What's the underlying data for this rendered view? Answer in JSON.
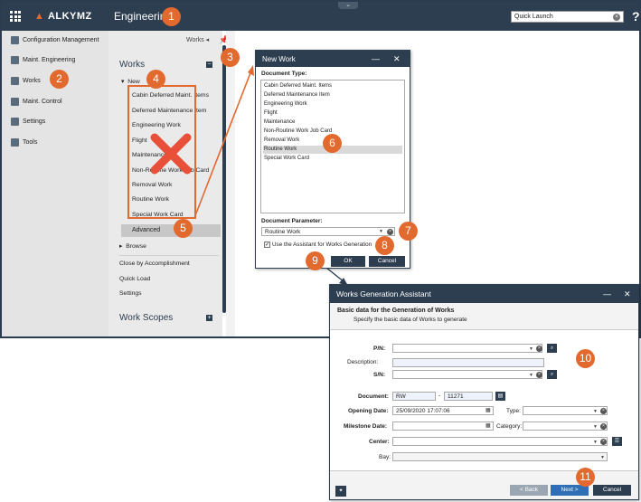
{
  "app": {
    "brand": "ALKYMZ",
    "title": "Engineering",
    "quick_launch_placeholder": "Quick Launch",
    "help": "?"
  },
  "nav": {
    "items": [
      {
        "label": "Configuration Management",
        "icon": "config-icon"
      },
      {
        "label": "Maint. Engineering",
        "icon": "maint-engineering-icon"
      },
      {
        "label": "Works",
        "icon": "works-icon"
      },
      {
        "label": "Maint. Control",
        "icon": "maint-control-icon"
      },
      {
        "label": "Settings",
        "icon": "gear-icon"
      },
      {
        "label": "Tools",
        "icon": "tools-icon"
      }
    ]
  },
  "panel": {
    "breadcrumb": "Works",
    "section_title": "Works",
    "new_label": "New",
    "new_items": [
      "Cabin Deferred Maint. Items",
      "Deferred Maintenance Item",
      "Engineering Work",
      "Flight",
      "Maintenance",
      "Non-Routine Work Job Card",
      "Removal Work",
      "Routine Work",
      "Special Work Card"
    ],
    "advanced": "Advanced",
    "browse": "Browse",
    "links": [
      "Close by Accomplishment",
      "Quick Load",
      "Settings"
    ],
    "scopes_title": "Work Scopes"
  },
  "new_work": {
    "title": "New Work",
    "doc_type_label": "Document Type:",
    "doc_types": [
      "Cabin Deferred Maint. Items",
      "Deferred Maintenance Item",
      "Engineering Work",
      "Flight",
      "Maintenance",
      "Non-Routine Work Job Card",
      "Removal Work",
      "Routine Work",
      "Special Work Card"
    ],
    "selected": "Routine Work",
    "doc_param_label": "Document Parameter:",
    "doc_param_value": "Routine Work",
    "assistant_checkbox": "Use the Assistant for Works Generation",
    "ok": "OK",
    "cancel": "Cancel"
  },
  "wizard": {
    "title": "Works Generation Assistant",
    "header": "Basic data for the Generation of Works",
    "subheader": "Specify the basic data of Works to generate",
    "pn_label": "P/N:",
    "description_label": "Description:",
    "sn_label": "S/N:",
    "document_label": "Document:",
    "document_prefix": "RW",
    "document_number": "11271",
    "opening_date_label": "Opening Date:",
    "opening_date": "25/09/2020 17:07:06",
    "type_label": "Type:",
    "milestone_label": "Milestone Date:",
    "category_label": "Category:",
    "center_label": "Center:",
    "bay_label": "Bay:",
    "back": "< Back",
    "next": "Next >",
    "cancel": "Cancel"
  },
  "callouts": [
    "1",
    "2",
    "3",
    "4",
    "5",
    "6",
    "7",
    "8",
    "9",
    "10",
    "11"
  ],
  "colors": {
    "header": "#2d3e50",
    "accent": "#e36a2e",
    "nav_bg": "#e4e4e4"
  }
}
